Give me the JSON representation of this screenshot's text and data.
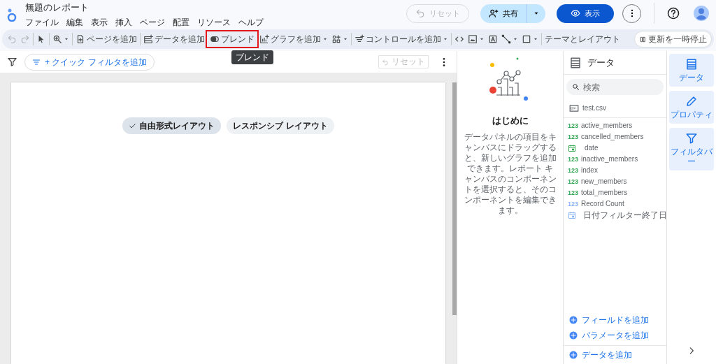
{
  "app": {
    "title": "無題のレポート"
  },
  "menu": [
    "ファイル",
    "編集",
    "表示",
    "挿入",
    "ページ",
    "配置",
    "リソース",
    "ヘルプ"
  ],
  "header_actions": {
    "reset": {
      "label": "リセット",
      "disabled": true
    },
    "share": "共有",
    "view": "表示"
  },
  "toolbar": [
    {
      "kind": "undo",
      "disabled": true
    },
    {
      "kind": "redo",
      "disabled": true
    },
    {
      "kind": "separator"
    },
    {
      "kind": "pointer",
      "disabled": false
    },
    {
      "kind": "separator"
    },
    {
      "kind": "zoom",
      "caret": true,
      "disabled": false
    },
    {
      "kind": "separator"
    },
    {
      "kind": "page",
      "label": "ページを追加",
      "disabled": false
    },
    {
      "kind": "separator"
    },
    {
      "kind": "data",
      "label": "データを追加",
      "disabled": false
    },
    {
      "kind": "blend",
      "label": "ブレンド",
      "disabled": false,
      "highlighted": true
    },
    {
      "kind": "chart",
      "label": "グラフを追加",
      "caret": true,
      "disabled": false
    },
    {
      "kind": "components",
      "caret": true,
      "disabled": false
    },
    {
      "kind": "separator"
    },
    {
      "kind": "control",
      "label": "コントロールを追加",
      "caret": true,
      "disabled": false
    },
    {
      "kind": "separator"
    },
    {
      "kind": "code",
      "disabled": false
    },
    {
      "kind": "image",
      "caret": true,
      "disabled": false
    },
    {
      "kind": "text",
      "disabled": false
    },
    {
      "kind": "line",
      "caret": true,
      "disabled": false
    },
    {
      "kind": "shape",
      "caret": true,
      "disabled": false
    },
    {
      "kind": "separator"
    },
    {
      "kind": "theme",
      "label": "テーマとレイアウト",
      "disabled": false
    },
    {
      "kind": "pause",
      "label": "更新を一時停止",
      "disabled": false
    }
  ],
  "tooltip": "ブレンド",
  "filter_bar": {
    "add_filter": "+ クイック フィルタを追加",
    "reset": {
      "label": "リセット",
      "disabled": true
    }
  },
  "layout_options": [
    {
      "label": "自由形式レイアウト",
      "selected": true
    },
    {
      "label": "レスポンシブ レイアウト",
      "selected": false
    }
  ],
  "getting_started": {
    "title": "はじめに",
    "text": "データパネルの項目をキャンバスにドラッグすると、新しいグラフを追加できます。レポート キャンバスのコンポーネントを選択すると、そのコンポーネントを編集できます。"
  },
  "data_panel": {
    "title": "データ",
    "search_placeholder": "検索",
    "source": "test.csv",
    "fields": [
      {
        "name": "active_members",
        "kind": "number",
        "type_label": "123",
        "color": "#34a853"
      },
      {
        "name": "cancelled_members",
        "kind": "number",
        "type_label": "123",
        "color": "#34a853"
      },
      {
        "name": "date",
        "kind": "date",
        "color": "#34a853"
      },
      {
        "name": "inactive_members",
        "kind": "number",
        "type_label": "123",
        "color": "#34a853"
      },
      {
        "name": "index",
        "kind": "number",
        "type_label": "123",
        "color": "#34a853"
      },
      {
        "name": "new_members",
        "kind": "number",
        "type_label": "123",
        "color": "#34a853"
      },
      {
        "name": "total_members",
        "kind": "number",
        "type_label": "123",
        "color": "#34a853"
      },
      {
        "name": "Record Count",
        "kind": "number",
        "type_label": "123",
        "color": "#8ab4f8"
      },
      {
        "name": "日付フィルター終了日",
        "kind": "date",
        "color": "#8ab4f8"
      }
    ],
    "actions": [
      "フィールドを追加",
      "パラメータを追加"
    ],
    "add_data": "データを追加"
  },
  "rail": [
    {
      "label": "データ",
      "kind": "data"
    },
    {
      "label": "プロパティ",
      "kind": "properties"
    },
    {
      "label": "フィルタバー",
      "kind": "filter"
    }
  ]
}
